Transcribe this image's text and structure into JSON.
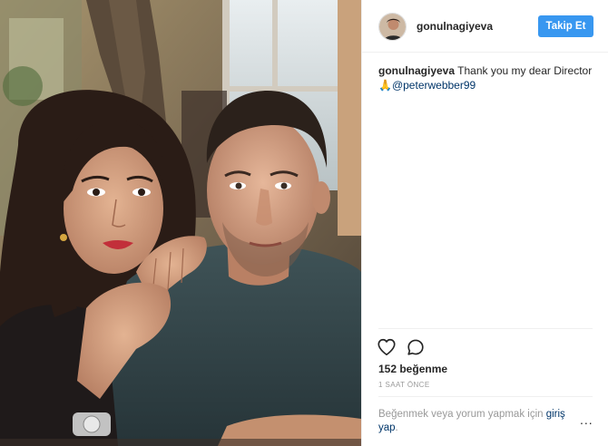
{
  "header": {
    "username": "gonulnagiyeva",
    "follow_label": "Takip Et",
    "avatar_icon": "profile-avatar"
  },
  "caption": {
    "username": "gonulnagiyeva",
    "text": " Thank you my dear Director ",
    "emoji": "🙏",
    "mention": "@peterwebber99"
  },
  "actions": {
    "like_icon": "heart-icon",
    "comment_icon": "speech-bubble-icon"
  },
  "likes": "152 beğenme",
  "timestamp": "1 SAAT ÖNCE",
  "login_prompt": {
    "text": "Beğenmek veya yorum yapmak için ",
    "link": "giriş yap",
    "suffix": "."
  },
  "more_options": "...",
  "colors": {
    "follow_button": "#3897f0",
    "link": "#003569",
    "muted_text": "#999999",
    "divider": "#efefef"
  }
}
